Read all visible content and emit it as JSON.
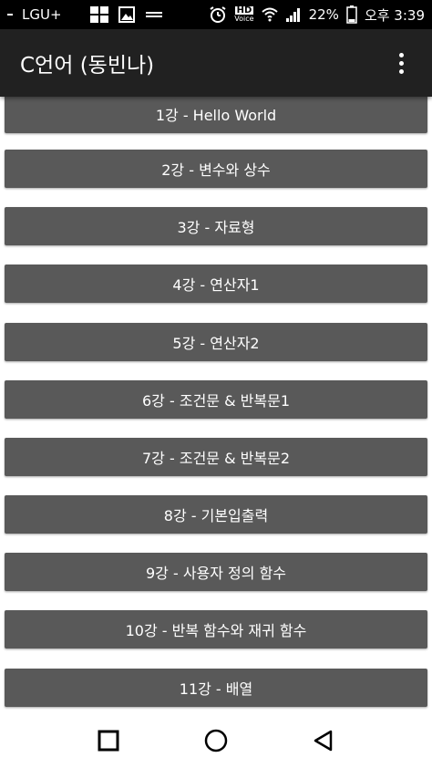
{
  "status_bar": {
    "carrier": "LGU+",
    "battery": "22%",
    "time": "오후 3:39",
    "hd_label": "HD",
    "hd_sub": "Voice"
  },
  "app_bar": {
    "title": "C언어 (동빈나)"
  },
  "lessons": [
    {
      "label": "1강 - Hello World"
    },
    {
      "label": "2강 -  변수와 상수"
    },
    {
      "label": "3강 - 자료형"
    },
    {
      "label": "4강 - 연산자1"
    },
    {
      "label": "5강 - 연산자2"
    },
    {
      "label": "6강 - 조건문 & 반복문1"
    },
    {
      "label": "7강 - 조건문 & 반복문2"
    },
    {
      "label": "8강 - 기본입출력"
    },
    {
      "label": "9강 - 사용자 정의 함수"
    },
    {
      "label": "10강 - 반복 함수와 재귀 함수"
    },
    {
      "label": "11강 - 배열"
    }
  ],
  "nav_bar": {
    "items": [
      {
        "icon": "recents-square-icon"
      },
      {
        "icon": "home-circle-icon"
      },
      {
        "icon": "back-triangle-icon"
      }
    ]
  }
}
